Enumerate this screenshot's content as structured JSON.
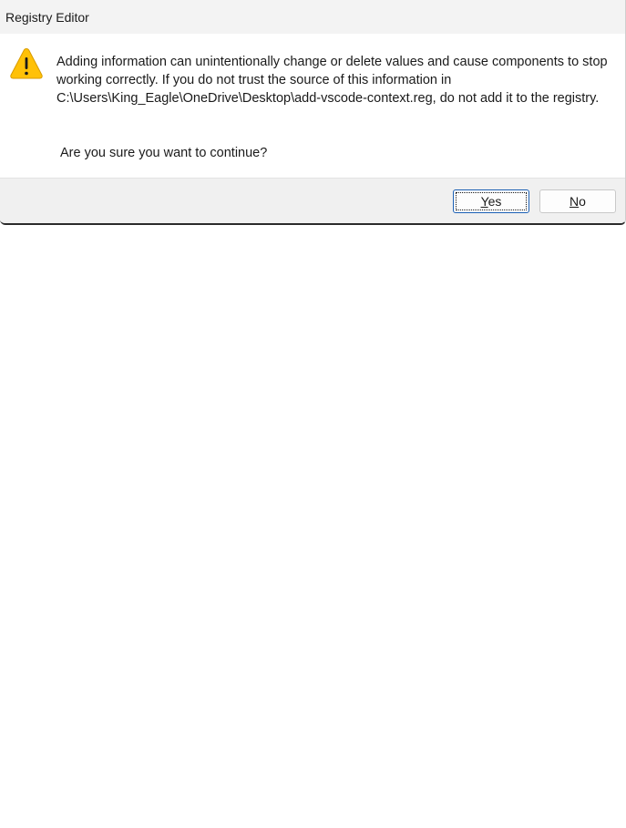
{
  "window": {
    "title": "Registry Editor"
  },
  "dialog": {
    "icon": "warning-icon",
    "message": "Adding information can unintentionally change or delete values and cause components to stop working correctly. If you do not trust the source of this information in C:\\Users\\King_Eagle\\OneDrive\\Desktop\\add-vscode-context.reg, do not add it to the registry.",
    "question": "Are you sure you want to continue?"
  },
  "buttons": {
    "yes": {
      "mnemonic": "Y",
      "rest": "es"
    },
    "no": {
      "mnemonic": "N",
      "rest": "o"
    }
  },
  "colors": {
    "warning_fill": "#FFC107",
    "warning_outline": "#D89B00",
    "focus_border": "#1A5FB4"
  }
}
